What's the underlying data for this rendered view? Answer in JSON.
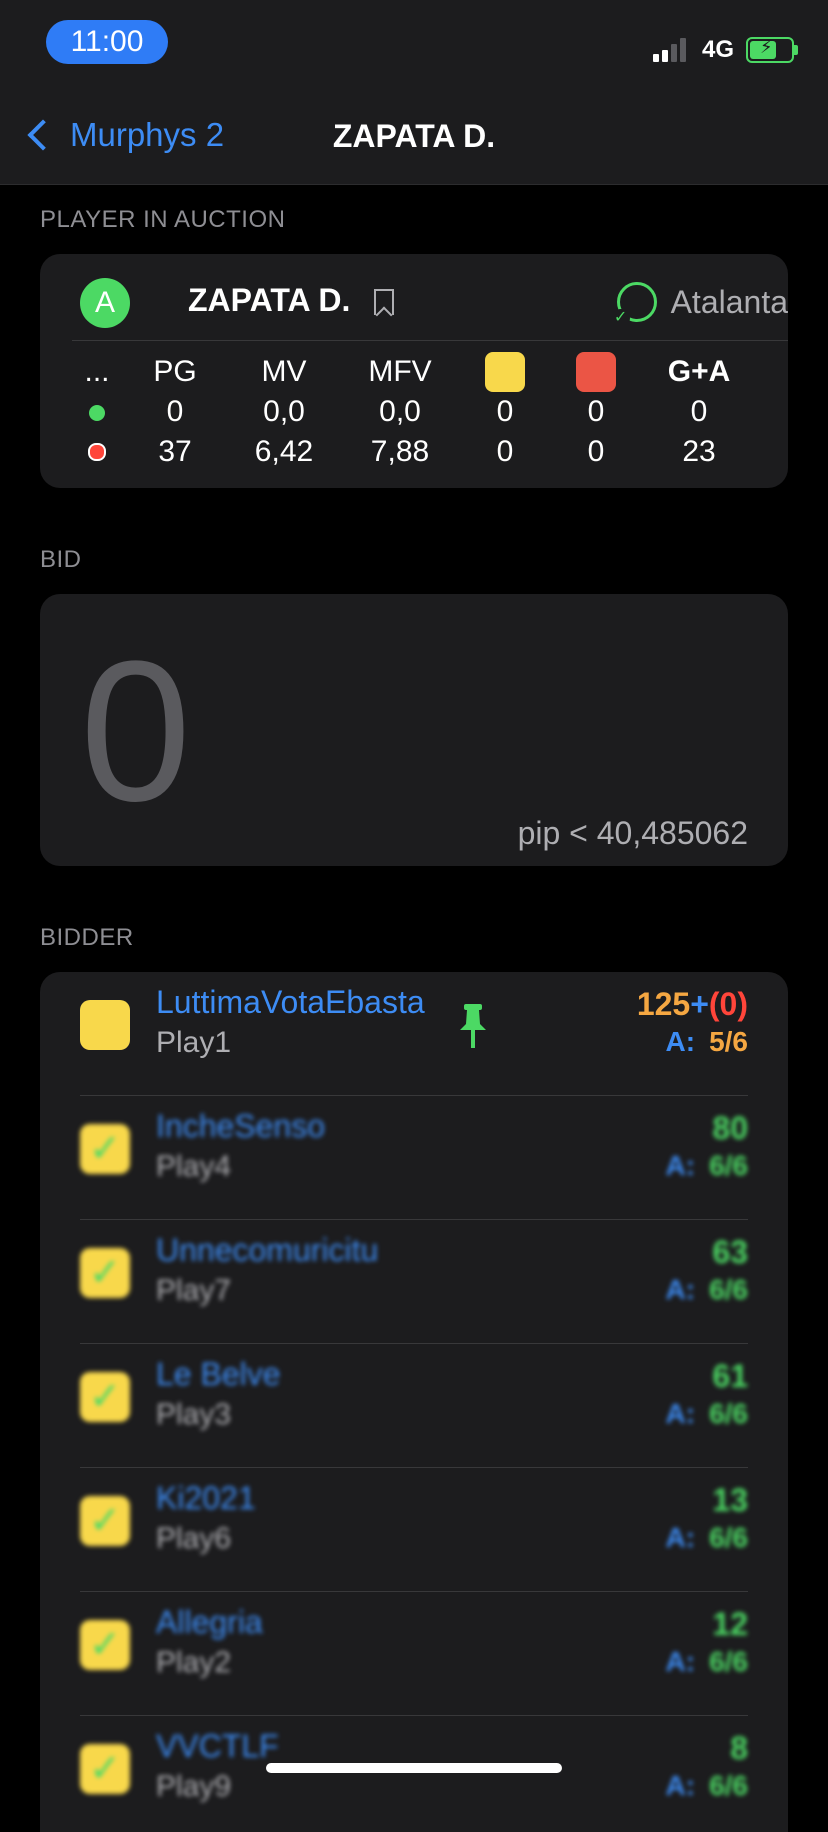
{
  "status_bar": {
    "time": "11:00",
    "network": "4G",
    "battery_charging": true
  },
  "nav": {
    "back_label": "Murphys 2",
    "title": "ZAPATA D."
  },
  "player_section": {
    "label": "PLAYER IN AUCTION",
    "avatar_letter": "A",
    "name": "ZAPATA D.",
    "team": "Atalanta",
    "stats": {
      "headers": [
        "...",
        "PG",
        "MV",
        "MFV",
        "yellow-card",
        "red-card",
        "G+A"
      ],
      "rows": [
        {
          "indicator_color": "#4cd964",
          "values": [
            "0",
            "0,0",
            "0,0",
            "0",
            "0",
            "0"
          ]
        },
        {
          "indicator_color": "#ff3b30",
          "values": [
            "37",
            "6,42",
            "7,88",
            "0",
            "0",
            "23"
          ]
        }
      ]
    }
  },
  "bid_section": {
    "label": "BID",
    "value": "0",
    "pip": "pip < 40,485062"
  },
  "bidder_section": {
    "label": "BIDDER",
    "slots_label": "A:",
    "bidders": [
      {
        "name": "LuttimaVotaEbasta",
        "player": "Play1",
        "amount": "125",
        "plus": "+",
        "extra": "(0)",
        "slots": "5/6",
        "pinned": true,
        "checked": false,
        "blurred": false
      },
      {
        "name": "IncheSenso",
        "player": "Play4",
        "amount": "80",
        "slots": "6/6",
        "checked": true,
        "blurred": true
      },
      {
        "name": "Unnecomuricitu",
        "player": "Play7",
        "amount": "63",
        "slots": "6/6",
        "checked": true,
        "blurred": true
      },
      {
        "name": "Le Belve",
        "player": "Play3",
        "amount": "61",
        "slots": "6/6",
        "checked": true,
        "blurred": true
      },
      {
        "name": "Ki2021",
        "player": "Play6",
        "amount": "13",
        "slots": "6/6",
        "checked": true,
        "blurred": true
      },
      {
        "name": "Allegria",
        "player": "Play2",
        "amount": "12",
        "slots": "6/6",
        "checked": true,
        "blurred": true
      },
      {
        "name": "VVCTLF",
        "player": "Play9",
        "amount": "8",
        "slots": "6/6",
        "checked": true,
        "blurred": true
      }
    ]
  },
  "colors": {
    "accent": "#3d8cf4",
    "green": "#4cd964",
    "orange": "#f5a742",
    "red": "#ff453a",
    "yellow": "#f8d84b",
    "card_red": "#eb5545"
  }
}
